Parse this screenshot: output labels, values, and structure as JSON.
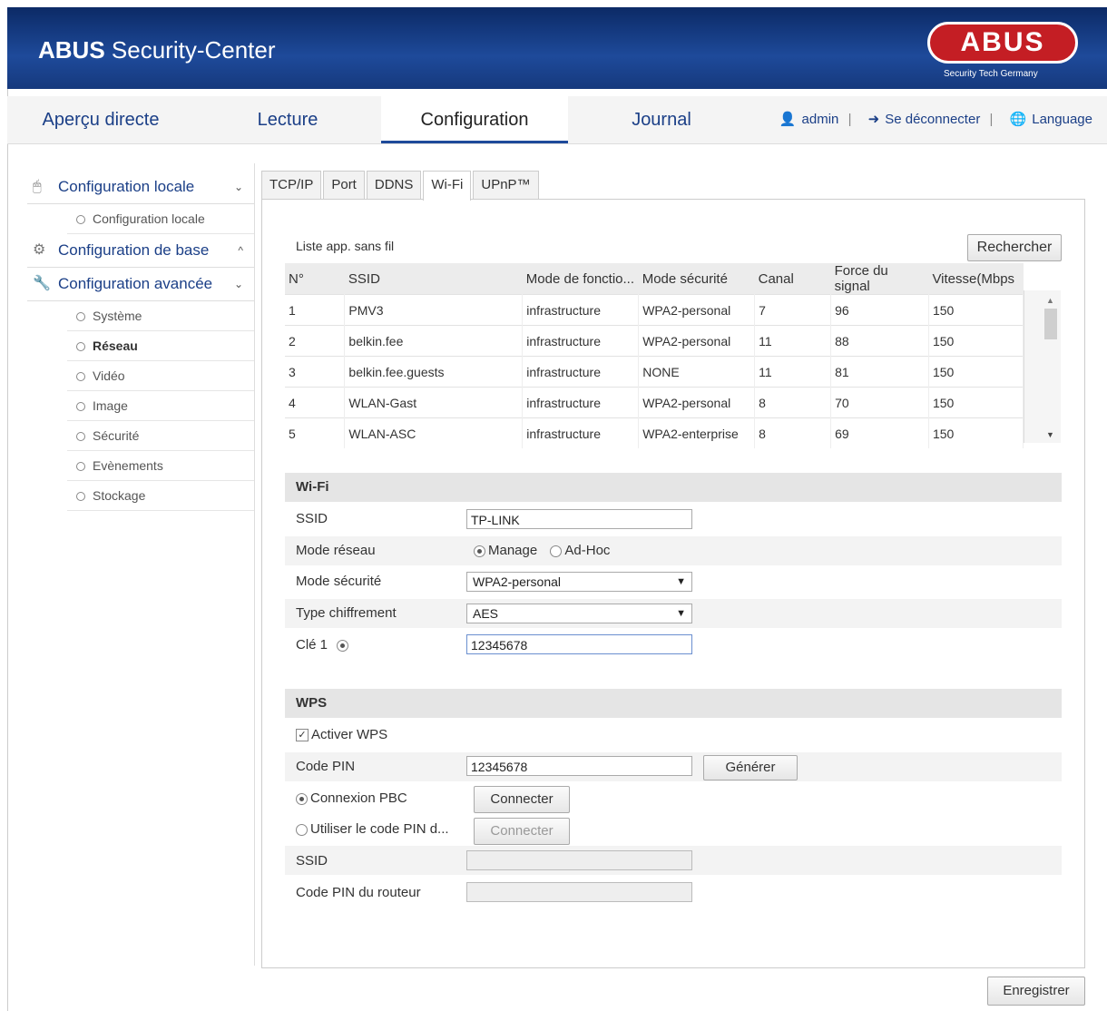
{
  "header": {
    "title_bold": "ABUS",
    "title_rest": " Security-Center",
    "logo_text": "ABUS",
    "logo_sub": "Security Tech Germany"
  },
  "nav": {
    "tabs": [
      "Aperçu directe",
      "Lecture",
      "Configuration",
      "Journal"
    ],
    "active": "Configuration",
    "user": "admin",
    "logout": "Se déconnecter",
    "language": "Language",
    "separator": "|"
  },
  "sidebar": {
    "local": {
      "label": "Configuration locale",
      "chevron": "⌄",
      "items": [
        "Configuration locale"
      ]
    },
    "base": {
      "label": "Configuration de base",
      "chevron": "^"
    },
    "advanced": {
      "label": "Configuration avancée",
      "chevron": "⌄",
      "items": [
        "Système",
        "Réseau",
        "Vidéo",
        "Image",
        "Sécurité",
        "Evènements",
        "Stockage"
      ],
      "active": "Réseau"
    }
  },
  "subtabs": {
    "items": [
      "TCP/IP",
      "Port",
      "DDNS",
      "Wi-Fi",
      "UPnP™"
    ],
    "active": "Wi-Fi"
  },
  "ap_list": {
    "title": "Liste app. sans fil",
    "search_button": "Rechercher",
    "columns": [
      "N°",
      "SSID",
      "Mode de fonctio...",
      "Mode sécurité",
      "Canal",
      "Force du signal",
      "Vitesse(Mbps"
    ],
    "rows": [
      [
        "1",
        "PMV3",
        "infrastructure",
        "WPA2-personal",
        "7",
        "96",
        "150"
      ],
      [
        "2",
        "belkin.fee",
        "infrastructure",
        "WPA2-personal",
        "11",
        "88",
        "150"
      ],
      [
        "3",
        "belkin.fee.guests",
        "infrastructure",
        "NONE",
        "11",
        "81",
        "150"
      ],
      [
        "4",
        "WLAN-Gast",
        "infrastructure",
        "WPA2-personal",
        "8",
        "70",
        "150"
      ],
      [
        "5",
        "WLAN-ASC",
        "infrastructure",
        "WPA2-enterprise",
        "8",
        "69",
        "150"
      ]
    ]
  },
  "wifi": {
    "section": "Wi-Fi",
    "ssid_label": "SSID",
    "ssid_value": "TP-LINK",
    "mode_label": "Mode réseau",
    "mode_options": [
      "Manage",
      "Ad-Hoc"
    ],
    "mode_selected": "Manage",
    "security_label": "Mode sécurité",
    "security_value": "WPA2-personal",
    "encryption_label": "Type chiffrement",
    "encryption_value": "AES",
    "key_label": "Clé 1",
    "key_value": "12345678"
  },
  "wps": {
    "section": "WPS",
    "enable_label": "Activer WPS",
    "enabled": true,
    "pin_label": "Code PIN",
    "pin_value": "12345678",
    "generate_button": "Générer",
    "pbc_label": "Connexion PBC",
    "connect_button": "Connecter",
    "use_pin_label": "Utiliser le code PIN d...",
    "connect_button_2": "Connecter",
    "ssid_label": "SSID",
    "router_pin_label": "Code PIN du routeur"
  },
  "save_button": "Enregistrer"
}
